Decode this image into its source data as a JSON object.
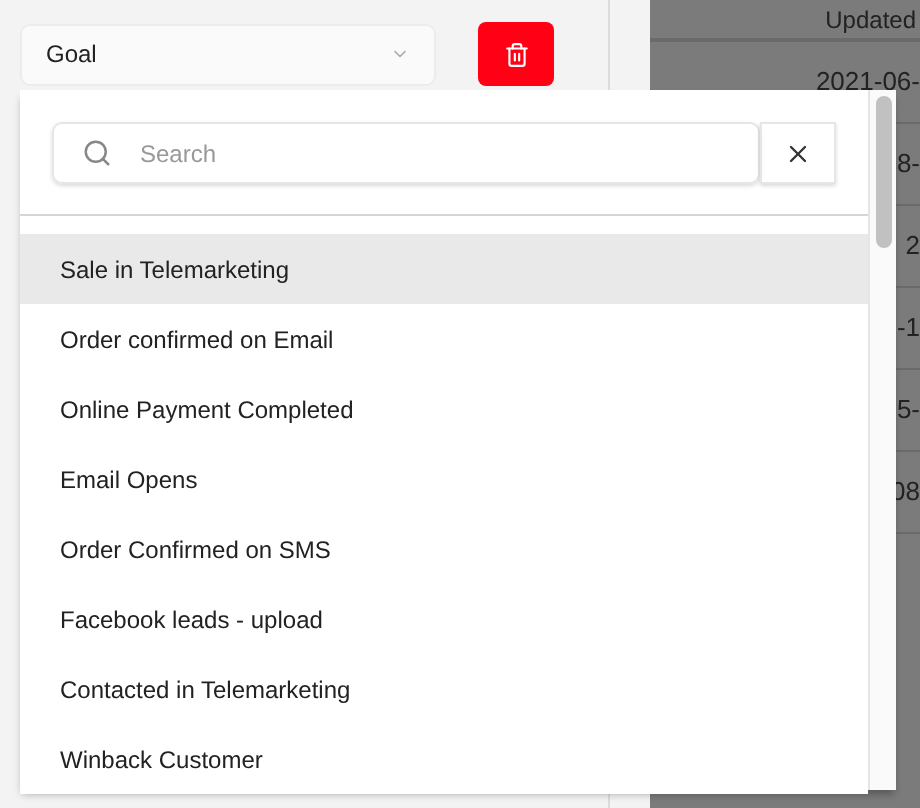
{
  "goal_select": {
    "value": "Goal"
  },
  "table": {
    "column_header": "Updated",
    "rows": [
      "2021-06-",
      "8-",
      "2",
      "-1",
      "5-",
      "08"
    ]
  },
  "dropdown": {
    "search": {
      "placeholder": "Search"
    },
    "options": [
      {
        "label": "Sale in Telemarketing",
        "selected": true
      },
      {
        "label": "Order confirmed on Email",
        "selected": false
      },
      {
        "label": "Online Payment Completed",
        "selected": false
      },
      {
        "label": "Email Opens",
        "selected": false
      },
      {
        "label": "Order Confirmed on SMS",
        "selected": false
      },
      {
        "label": "Facebook leads - upload",
        "selected": false
      },
      {
        "label": "Contacted in Telemarketing",
        "selected": false
      },
      {
        "label": "Winback Customer",
        "selected": false
      }
    ]
  }
}
